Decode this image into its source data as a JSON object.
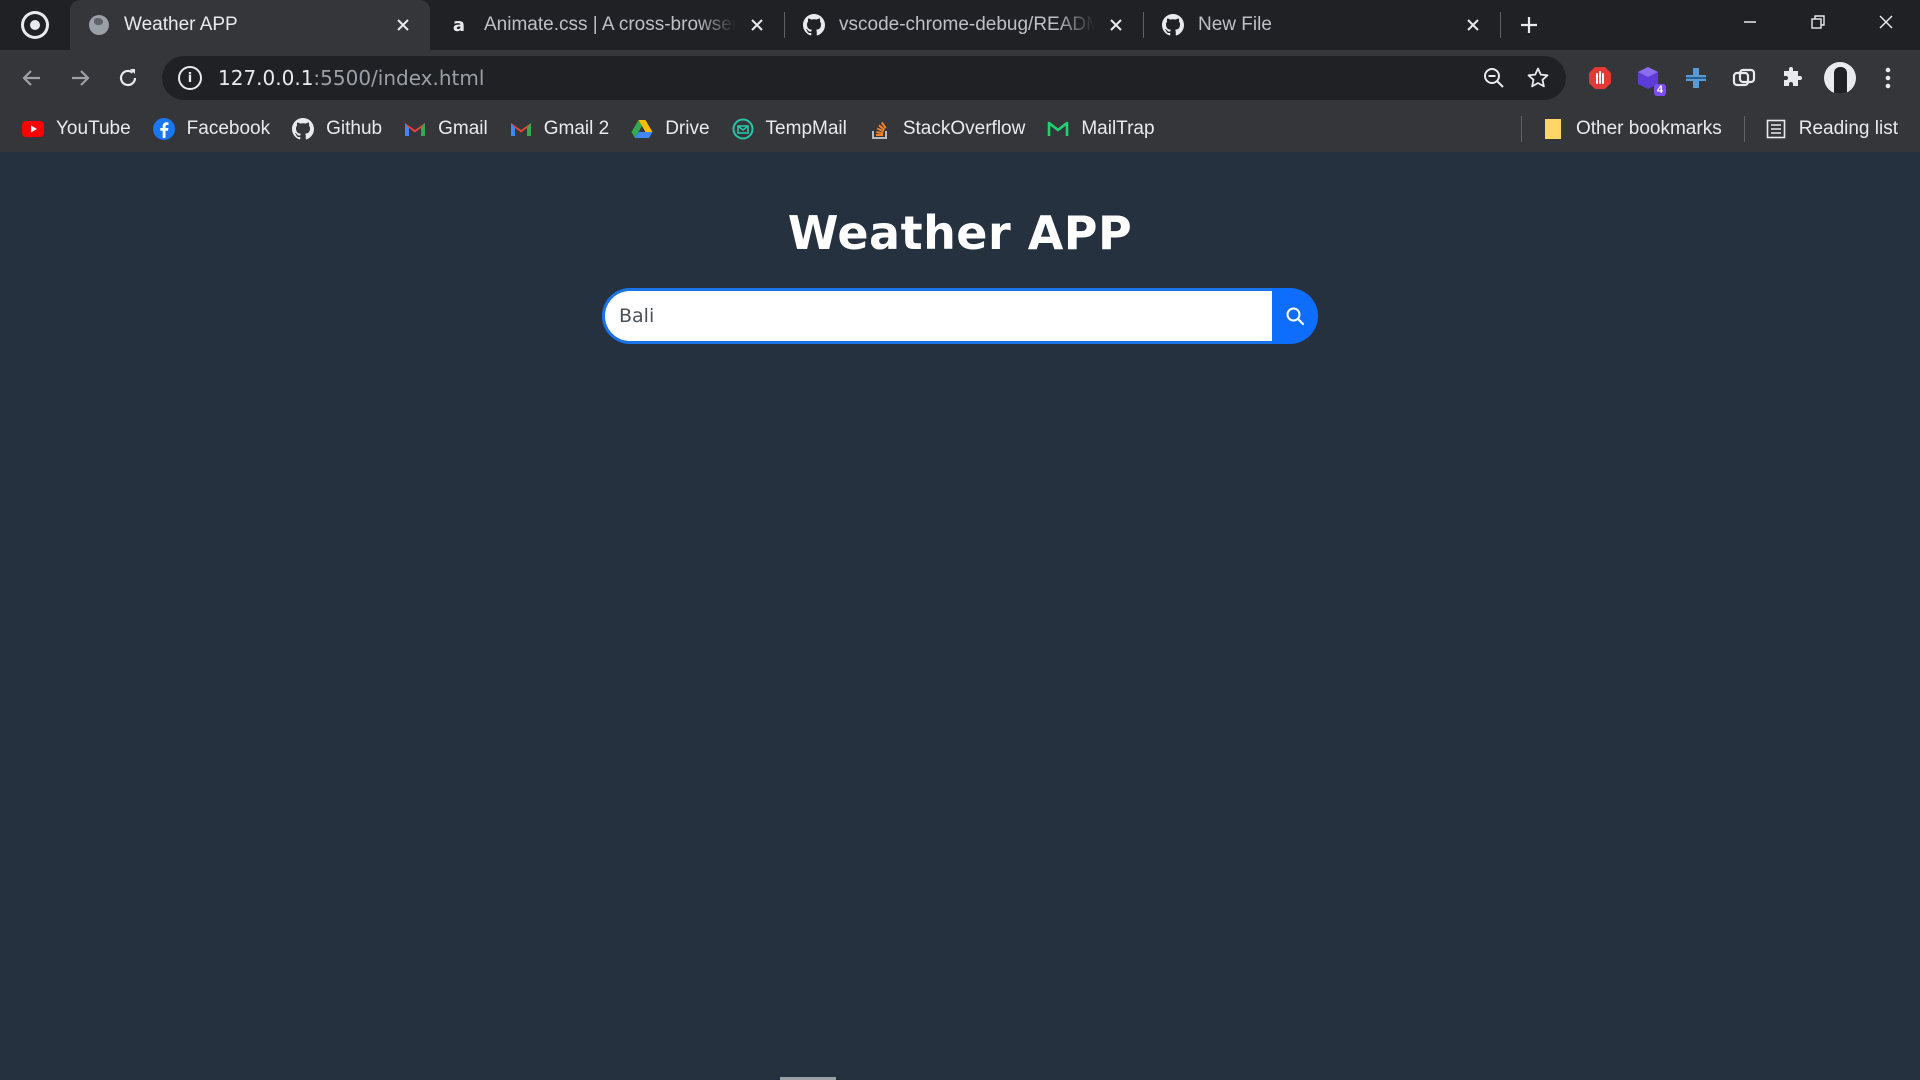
{
  "tabs": [
    {
      "title": "Weather APP",
      "active": true,
      "icon": "globe-icon"
    },
    {
      "title": "Animate.css | A cross-browser library of CSS animations",
      "active": false,
      "icon": "animate-icon"
    },
    {
      "title": "vscode-chrome-debug/README.md",
      "active": false,
      "icon": "github-icon"
    },
    {
      "title": "New File",
      "active": false,
      "icon": "github-icon"
    }
  ],
  "pinned_tab": {
    "icon": "whatsapp-icon"
  },
  "animate_icon_letter": "a",
  "address_bar": {
    "host": "127.0.0.1",
    "rest": ":5500/index.html"
  },
  "bookmarks": [
    {
      "label": "YouTube",
      "icon": "youtube-icon"
    },
    {
      "label": "Facebook",
      "icon": "facebook-icon"
    },
    {
      "label": "Github",
      "icon": "github-icon"
    },
    {
      "label": "Gmail",
      "icon": "gmail-icon"
    },
    {
      "label": "Gmail 2",
      "icon": "gmail-icon"
    },
    {
      "label": "Drive",
      "icon": "drive-icon"
    },
    {
      "label": "TempMail",
      "icon": "tempmail-icon"
    },
    {
      "label": "StackOverflow",
      "icon": "stackoverflow-icon"
    },
    {
      "label": "MailTrap",
      "icon": "mailtrap-icon"
    }
  ],
  "other_bookmarks": "Other bookmarks",
  "reading_list": "Reading list",
  "extension_badge": "4",
  "page": {
    "title": "Weather APP",
    "search_value": "Bali"
  },
  "colors": {
    "page_bg": "#263140",
    "search_button": "#0d6efd",
    "input_border": "#1a73e8"
  }
}
